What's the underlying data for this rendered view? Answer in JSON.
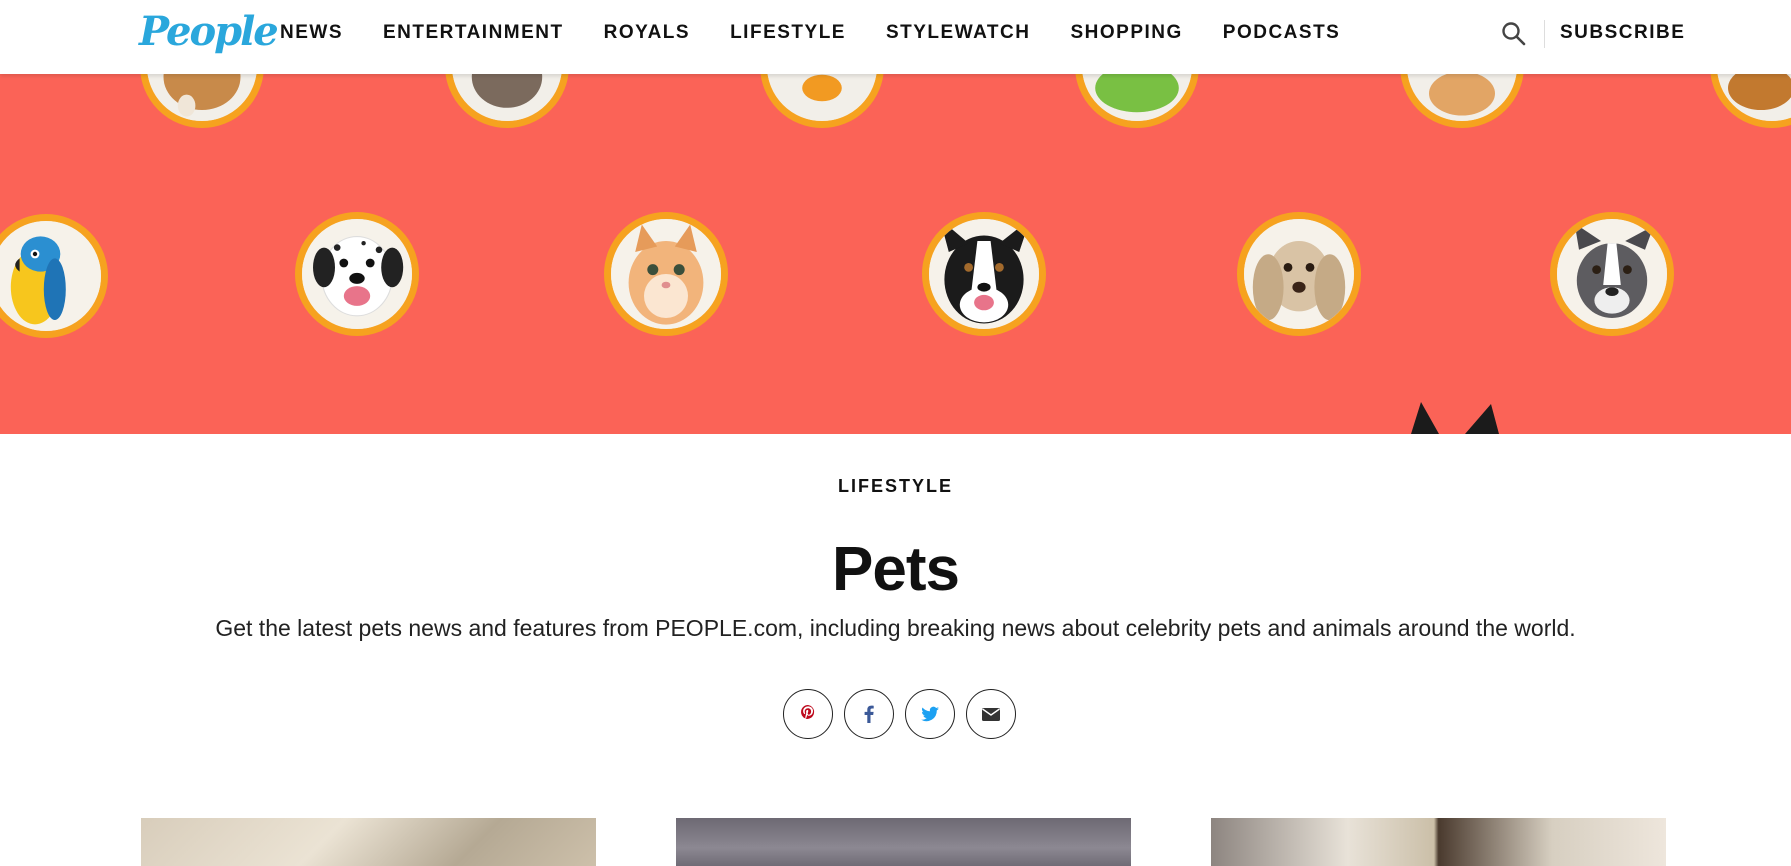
{
  "header": {
    "logo": "People",
    "nav": [
      "NEWS",
      "ENTERTAINMENT",
      "ROYALS",
      "LIFESTYLE",
      "STYLEWATCH",
      "SHOPPING",
      "PODCASTS"
    ],
    "subscribe": "SUBSCRIBE",
    "search_icon": "search-icon"
  },
  "hero": {
    "background_color": "#fb6357",
    "ring_color": "#f6a21f",
    "pets": [
      "parrot",
      "dalmatian",
      "kitten",
      "border-collie",
      "cocker-spaniel",
      "pit-bull"
    ]
  },
  "main": {
    "category": "LIFESTYLE",
    "title": "Pets",
    "description": "Get the latest pets news and features from PEOPLE.com, including breaking news about celebrity pets and animals around the world."
  },
  "share": {
    "buttons": [
      "pinterest-icon",
      "facebook-icon",
      "twitter-icon",
      "email-icon"
    ],
    "colors": {
      "pinterest": "#bd081c",
      "facebook": "#3b5998",
      "twitter": "#1da1f2",
      "email": "#333333"
    }
  },
  "cards": [
    "card-1",
    "card-2",
    "card-3"
  ]
}
